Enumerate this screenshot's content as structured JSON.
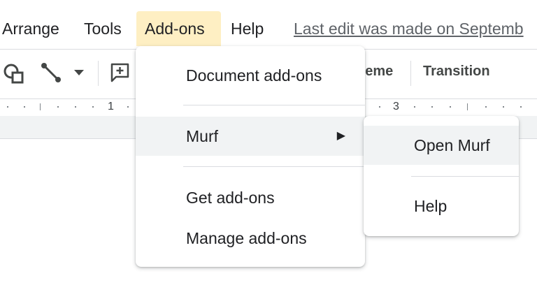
{
  "menubar": {
    "items": [
      "Arrange",
      "Tools",
      "Add-ons",
      "Help"
    ],
    "active": "Add-ons",
    "last_edit": "Last edit was made on Septemb"
  },
  "toolbar": {
    "theme_label": "heme",
    "transition_label": "Transition",
    "icons": [
      "shape-icon",
      "line-icon",
      "dropdown-caret-icon",
      "comment-add-icon"
    ]
  },
  "ruler": {
    "label_1": "1",
    "label_3": "3"
  },
  "addons_menu": {
    "document_addons": "Document add-ons",
    "murf": "Murf",
    "get_addons": "Get add-ons",
    "manage_addons": "Manage add-ons",
    "submenu_arrow": "▶"
  },
  "murf_submenu": {
    "open_murf": "Open Murf",
    "help": "Help"
  },
  "colors": {
    "active_menu_bg": "#feefc3",
    "hover_bg": "#f1f3f4"
  }
}
